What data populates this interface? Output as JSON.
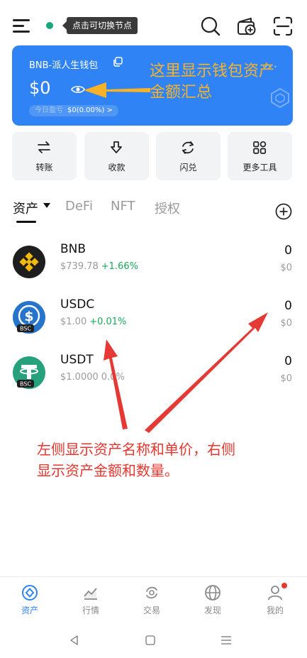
{
  "header": {
    "node_tooltip": "点击可切换节点",
    "icons": [
      "menu-icon",
      "search-icon",
      "add-wallet-icon",
      "scan-icon"
    ],
    "status_color": "#17a77a"
  },
  "wallet": {
    "name": "BNB-派人生钱包",
    "balance": "$0",
    "pnl_label": "今日盈亏",
    "pnl_value": "$0(0.00%) >",
    "more": "···",
    "card_color": "#2f83f4"
  },
  "annotations": {
    "card_note": "这里显示钱包资产金额汇总",
    "card_note_line1": "这里显示钱包资产",
    "card_note_line2": "金额汇总",
    "list_note": "左侧显示资产名称和单价，右侧显示资产金额和数量。",
    "list_note_line1": "左侧显示资产名称和单价，右侧",
    "list_note_line2": "显示资产金额和数量。",
    "card_note_color": "#f7b228",
    "list_note_color": "#e8352e"
  },
  "actions": [
    {
      "label": "转账",
      "icon": "transfer-icon"
    },
    {
      "label": "收款",
      "icon": "receive-icon"
    },
    {
      "label": "闪兑",
      "icon": "swap-icon"
    },
    {
      "label": "更多工具",
      "icon": "more-tools-icon"
    }
  ],
  "tabs": [
    {
      "label": "资产",
      "active": true
    },
    {
      "label": "DeFi",
      "active": false
    },
    {
      "label": "NFT",
      "active": false
    },
    {
      "label": "授权",
      "active": false
    }
  ],
  "assets": [
    {
      "symbol": "BNB",
      "price": "$739.78",
      "change": "+1.66%",
      "amount": "0",
      "value": "$0",
      "icon": "bnb-logo-icon"
    },
    {
      "symbol": "USDC",
      "price": "$1.00",
      "change": "+0.01%",
      "amount": "0",
      "value": "$0",
      "icon": "usdc-logo-icon",
      "chain": "BSC"
    },
    {
      "symbol": "USDT",
      "price": "$1.0000",
      "change": "0.0%",
      "amount": "0",
      "value": "$0",
      "icon": "usdt-logo-icon",
      "chain": "BSC"
    }
  ],
  "bottom_nav": [
    {
      "label": "资产",
      "active": true,
      "icon": "assets-icon"
    },
    {
      "label": "行情",
      "active": false,
      "icon": "market-icon"
    },
    {
      "label": "交易",
      "active": false,
      "icon": "trade-icon"
    },
    {
      "label": "发现",
      "active": false,
      "icon": "discover-icon"
    },
    {
      "label": "我的",
      "active": false,
      "icon": "profile-icon"
    }
  ],
  "colors": {
    "accent": "#2f83f4",
    "positive": "#18a957",
    "badge": "#e8352e"
  }
}
